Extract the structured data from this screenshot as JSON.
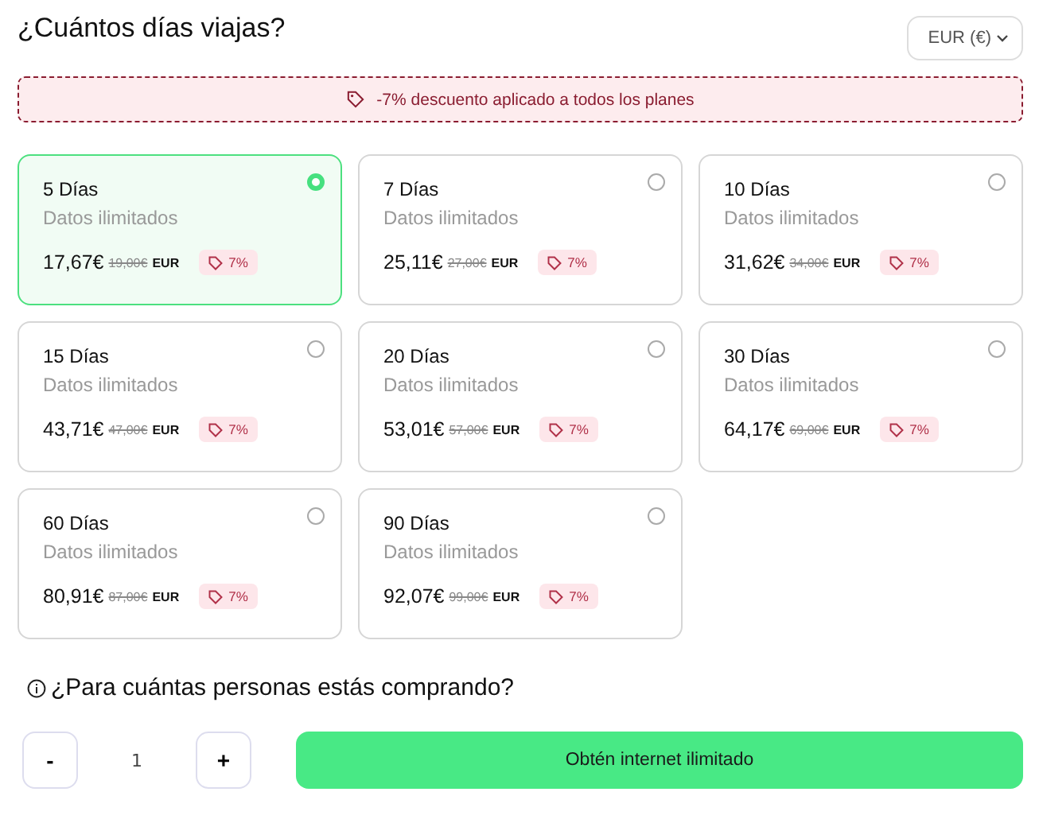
{
  "title": "¿Cuántos días viajas?",
  "currency": "EUR (€)",
  "banner": "-7% descuento aplicado a todos los planes",
  "plans": [
    {
      "days": "5 Días",
      "data": "Datos ilimitados",
      "price": "17,67€",
      "old_price": "19,00€",
      "unit": "EUR",
      "discount": "7%",
      "selected": true
    },
    {
      "days": "7 Días",
      "data": "Datos ilimitados",
      "price": "25,11€",
      "old_price": "27,00€",
      "unit": "EUR",
      "discount": "7%",
      "selected": false
    },
    {
      "days": "10 Días",
      "data": "Datos ilimitados",
      "price": "31,62€",
      "old_price": "34,00€",
      "unit": "EUR",
      "discount": "7%",
      "selected": false
    },
    {
      "days": "15 Días",
      "data": "Datos ilimitados",
      "price": "43,71€",
      "old_price": "47,00€",
      "unit": "EUR",
      "discount": "7%",
      "selected": false
    },
    {
      "days": "20 Días",
      "data": "Datos ilimitados",
      "price": "53,01€",
      "old_price": "57,00€",
      "unit": "EUR",
      "discount": "7%",
      "selected": false
    },
    {
      "days": "30 Días",
      "data": "Datos ilimitados",
      "price": "64,17€",
      "old_price": "69,00€",
      "unit": "EUR",
      "discount": "7%",
      "selected": false
    },
    {
      "days": "60 Días",
      "data": "Datos ilimitados",
      "price": "80,91€",
      "old_price": "87,00€",
      "unit": "EUR",
      "discount": "7%",
      "selected": false
    },
    {
      "days": "90 Días",
      "data": "Datos ilimitados",
      "price": "92,07€",
      "old_price": "99,00€",
      "unit": "EUR",
      "discount": "7%",
      "selected": false
    }
  ],
  "question": "¿Para cuántas personas estás comprando?",
  "minus": "-",
  "quantity": "1",
  "plus": "+",
  "cta": "Obtén internet ilimitado"
}
